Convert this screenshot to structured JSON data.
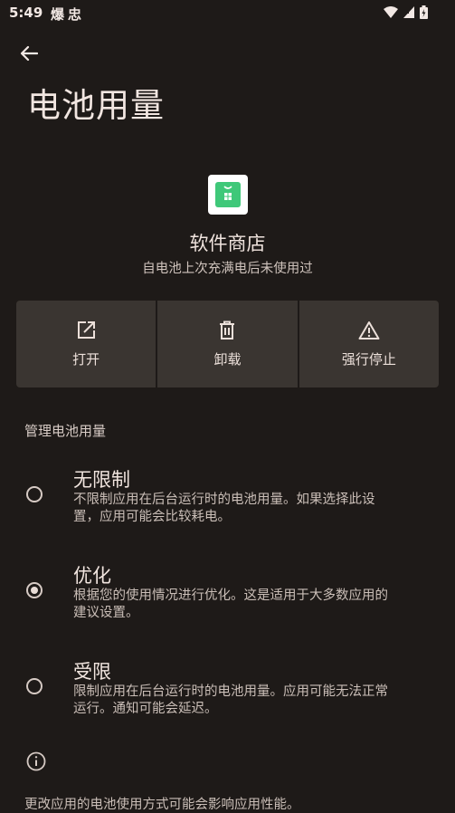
{
  "status_bar": {
    "time": "5:49",
    "notif_1": "爆",
    "notif_2": "忠",
    "icons": [
      "wifi-icon",
      "signal-icon",
      "battery-icon"
    ]
  },
  "header": {
    "back_icon": "arrow-back-icon",
    "title": "电池用量"
  },
  "app": {
    "icon": "app-store-icon",
    "name": "软件商店",
    "subtitle": "自电池上次充满电后未使用过"
  },
  "actions": [
    {
      "icon": "open-external-icon",
      "label": "打开"
    },
    {
      "icon": "trash-icon",
      "label": "卸载"
    },
    {
      "icon": "warning-icon",
      "label": "强行停止"
    }
  ],
  "section": {
    "title": "管理电池用量"
  },
  "options": [
    {
      "title": "无限制",
      "desc_line1": "不限制应用在后台运行时的电池用量。如果选择此设",
      "desc_line2": "置，应用可能会比较耗电。",
      "selected": false
    },
    {
      "title": "优化",
      "desc_line1": "根据您的使用情况进行优化。这是适用于大多数应用的",
      "desc_line2": "建议设置。",
      "selected": true
    },
    {
      "title": "受限",
      "desc_line1": "限制应用在后台运行时的电池用量。应用可能无法正常",
      "desc_line2": "运行。通知可能会延迟。",
      "selected": false
    }
  ],
  "footer": {
    "icon": "info-icon",
    "note": "更改应用的电池使用方式可能会影响应用性能。"
  },
  "colors": {
    "background": "#1e1a18",
    "button_bg": "#3a3531",
    "text_primary": "#ece0da",
    "app_icon_green": "#3fc879"
  }
}
